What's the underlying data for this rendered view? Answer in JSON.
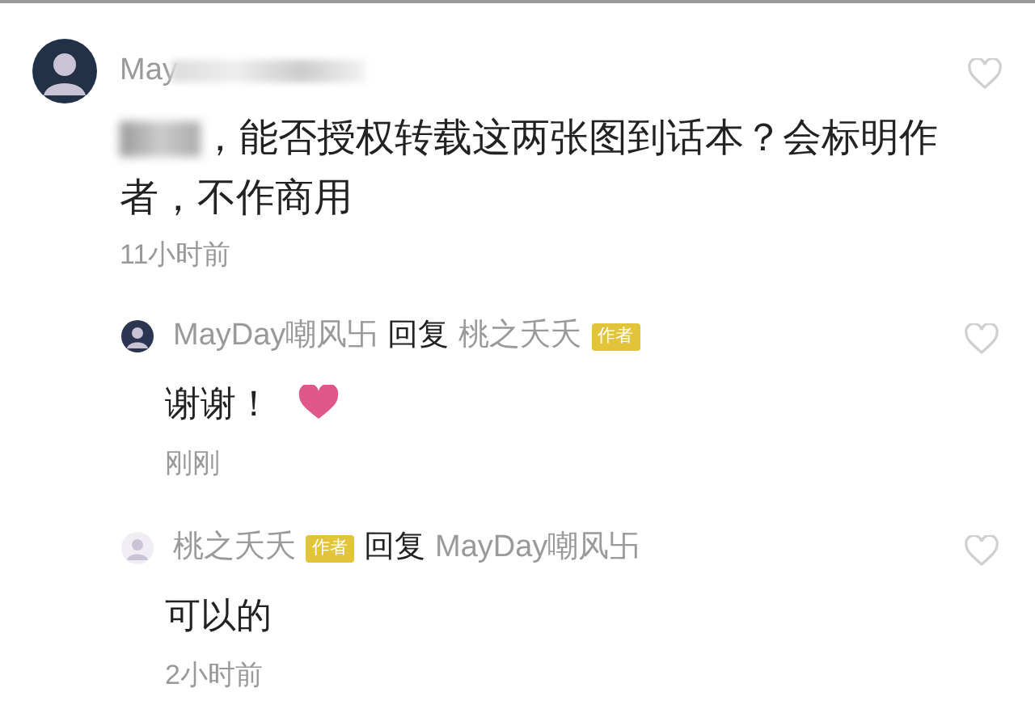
{
  "comments": [
    {
      "kind": "top",
      "author": {
        "name": "May",
        "blurred": true
      },
      "text": "，能否授权转载这两张图到话本？会标明作者，不作商用",
      "text_blurred_prefix": true,
      "time": "11小时前",
      "liked": false
    },
    {
      "kind": "reply",
      "author": {
        "name": "MayDay嘲风卐"
      },
      "reply_label": "回复",
      "reply_to": {
        "name": "桃之夭夭",
        "badge": "作者"
      },
      "text": "谢谢！",
      "heart_reaction": true,
      "time": "刚刚",
      "liked": false
    },
    {
      "kind": "reply",
      "author": {
        "name": "桃之夭夭",
        "badge": "作者"
      },
      "reply_label": "回复",
      "reply_to": {
        "name": "MayDay嘲风卐"
      },
      "text": "可以的",
      "time": "2小时前",
      "liked": false
    }
  ]
}
